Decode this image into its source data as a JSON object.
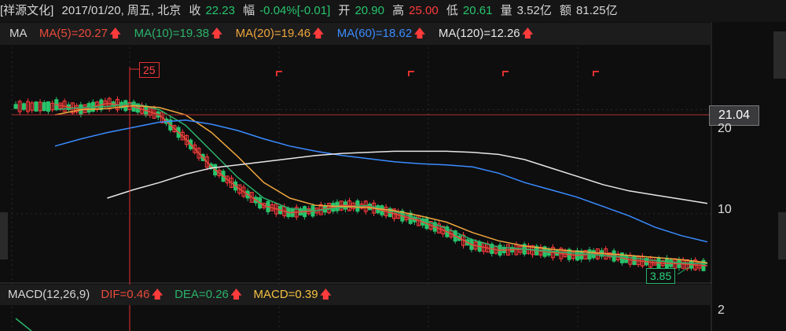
{
  "info": {
    "name": "[祥源文化]",
    "date": "2017/01/20, 周五, 北京",
    "close_label": "收",
    "close_value": "22.23",
    "change_label": "幅",
    "change_value": "-0.04%[-0.01]",
    "open_label": "开",
    "open_value": "20.90",
    "high_label": "高",
    "high_value": "25.00",
    "low_label": "低",
    "low_value": "20.61",
    "volume_label": "量",
    "volume_value": "3.52亿",
    "amount_label": "额",
    "amount_value": "81.25亿"
  },
  "ma_bar": {
    "label": "MA",
    "ma5": "MA(5)=20.27",
    "ma10": "MA(10)=19.38",
    "ma20": "MA(20)=19.46",
    "ma60": "MA(60)=18.62",
    "ma120": "MA(120)=12.26",
    "arrow": "🡅"
  },
  "macd_bar": {
    "label": "MACD(12,26,9)",
    "dif": "DIF=0.46",
    "dea": "DEA=0.26",
    "macd": "MACD=0.39",
    "arrow": "🡅"
  },
  "price_axis": {
    "current_price": "21.04",
    "tick_20": "20",
    "tick_10": "10",
    "macd_tick": "2"
  },
  "markers": {
    "high": "25",
    "low": "3.85"
  },
  "colors": {
    "up": "#ff3b3b",
    "down": "#27c46b",
    "ma5": "#e84a3a",
    "ma10": "#2bb36a",
    "ma20": "#f0a53c",
    "ma60": "#3a8cff",
    "ma120": "#e6e6e6"
  },
  "chart_data": {
    "type": "line",
    "xlabel": "",
    "ylabel": "",
    "ylim": [
      3.5,
      26
    ],
    "series": [
      {
        "name": "MA(5)",
        "values": [
          20.5,
          20.0,
          20.6,
          20.3,
          19.5,
          17.2,
          14.5,
          12.5,
          10.8,
          10.1,
          10.3,
          10.8,
          10.7,
          10.0,
          9.3,
          8.3,
          7.0,
          6.5,
          6.6,
          6.3,
          6.0,
          6.2,
          5.6,
          5.3,
          5.2,
          5.0
        ]
      },
      {
        "name": "MA(10)",
        "values": [
          20.0,
          20.2,
          20.3,
          20.6,
          20.0,
          18.5,
          16.0,
          13.5,
          11.5,
          10.5,
          10.3,
          10.6,
          10.8,
          10.2,
          9.5,
          8.6,
          7.5,
          6.8,
          6.6,
          6.4,
          6.2,
          6.0,
          5.8,
          5.5,
          5.3,
          5.2
        ]
      },
      {
        "name": "MA(20)",
        "values": [
          19.5,
          20.0,
          20.1,
          20.4,
          20.2,
          19.5,
          17.8,
          15.5,
          13.0,
          11.5,
          10.8,
          10.7,
          10.6,
          10.3,
          9.8,
          9.2,
          8.2,
          7.4,
          6.9,
          6.6,
          6.4,
          6.2,
          6.0,
          5.8,
          5.6,
          5.3
        ]
      },
      {
        "name": "MA(60)",
        "values": [
          16.5,
          17.2,
          17.8,
          18.3,
          18.8,
          19.0,
          18.6,
          18.0,
          17.2,
          16.5,
          16.0,
          15.6,
          15.3,
          15.0,
          14.8,
          14.7,
          14.5,
          13.9,
          13.0,
          12.3,
          11.6,
          10.7,
          9.8,
          8.7,
          7.9,
          7.3
        ]
      },
      {
        "name": "MA(120)",
        "values": [
          null,
          null,
          11.5,
          12.3,
          13.0,
          13.8,
          14.4,
          14.7,
          15.0,
          15.3,
          15.6,
          15.8,
          15.9,
          16.0,
          16.0,
          16.0,
          15.9,
          15.7,
          15.2,
          14.4,
          13.6,
          12.8,
          12.2,
          11.8,
          11.4,
          11.0
        ]
      }
    ]
  }
}
